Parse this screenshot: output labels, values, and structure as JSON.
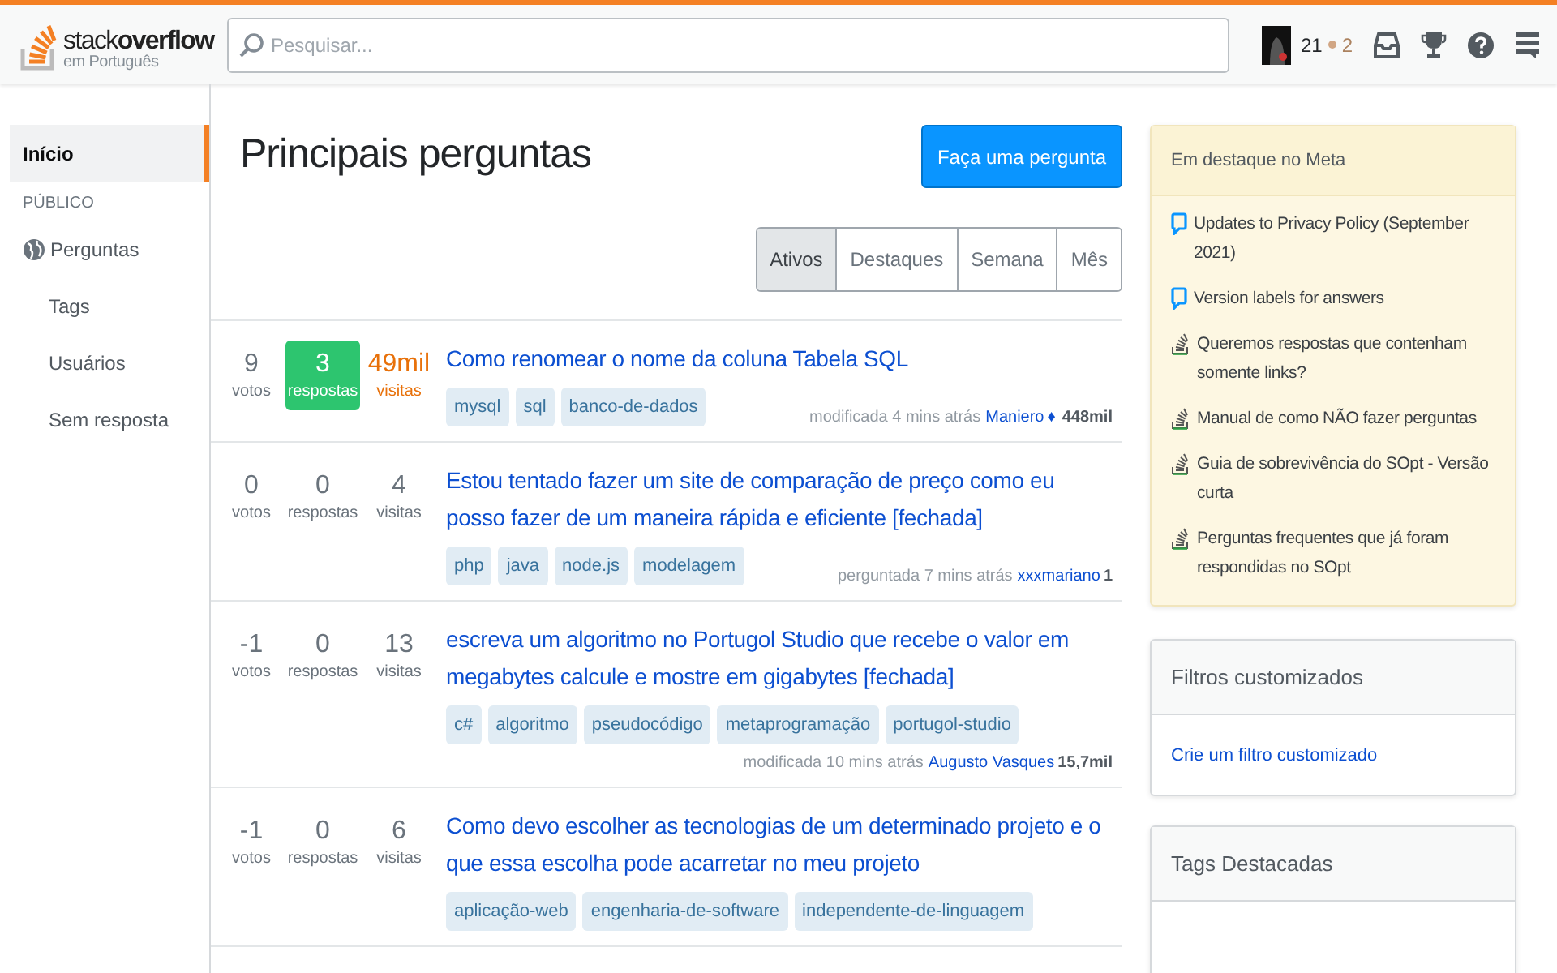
{
  "header": {
    "logo_main": "stack",
    "logo_bold": "overflow",
    "logo_sub": "em Português",
    "search": {
      "placeholder": "Pesquisar..."
    },
    "reputation": "21",
    "bronze": "2"
  },
  "sidebar": {
    "items": [
      {
        "label": "Início",
        "selected": true
      }
    ],
    "section": {
      "title": "PÚBLICO",
      "items": [
        {
          "label": "Perguntas",
          "kind": "globe",
          "selected": false
        },
        {
          "label": "Tags",
          "kind": "sub",
          "selected": false
        },
        {
          "label": "Usuários",
          "kind": "sub",
          "selected": false
        },
        {
          "label": "Sem resposta",
          "kind": "sub",
          "selected": false
        }
      ]
    }
  },
  "main": {
    "title": "Principais perguntas",
    "ask_button": "Faça uma pergunta",
    "tabs": [
      {
        "label": "Ativos",
        "selected": true
      },
      {
        "label": "Destaques",
        "selected": false
      },
      {
        "label": "Semana",
        "selected": false
      },
      {
        "label": "Mês",
        "selected": false
      }
    ],
    "questions": [
      {
        "votes": "9",
        "votes_label": "votos",
        "answers": "3",
        "answers_label": "respostas",
        "answered": true,
        "views": "49mil",
        "views_label": "visitas",
        "hot": true,
        "title": "Como renomear o nome da coluna Tabela SQL",
        "tags": [
          "mysql",
          "sql",
          "banco-de-dados"
        ],
        "action": "modificada 4 mins atrás",
        "user": "Maniero",
        "diamond": "♦",
        "rep": "448mil"
      },
      {
        "votes": "0",
        "votes_label": "votos",
        "answers": "0",
        "answers_label": "respostas",
        "answered": false,
        "views": "4",
        "views_label": "visitas",
        "hot": false,
        "title": "Estou tentado fazer um site de comparação de preço como eu posso fazer de um maneira rápida e eficiente [fechada]",
        "tags": [
          "php",
          "java",
          "node.js",
          "modelagem"
        ],
        "action": "perguntada 7 mins atrás",
        "user": "xxxmariano",
        "rep": "1"
      },
      {
        "votes": "-1",
        "votes_label": "votos",
        "answers": "0",
        "answers_label": "respostas",
        "answered": false,
        "views": "13",
        "views_label": "visitas",
        "hot": false,
        "title": "escreva um algoritmo no Portugol Studio que recebe o valor em megabytes calcule e mostre em gigabytes [fechada]",
        "tags": [
          "c#",
          "algoritmo",
          "pseudocódigo",
          "metaprogramação",
          "portugol-studio"
        ],
        "action": "modificada 10 mins atrás",
        "user": "Augusto Vasques",
        "rep": "15,7mil"
      },
      {
        "votes": "-1",
        "votes_label": "votos",
        "answers": "0",
        "answers_label": "respostas",
        "answered": false,
        "views": "6",
        "views_label": "visitas",
        "hot": false,
        "title": "Como devo escolher as tecnologias de um determinado projeto e o que essa escolha pode acarretar no meu projeto",
        "tags": [
          "aplicação-web",
          "engenharia-de-software",
          "independente-de-linguagem"
        ]
      }
    ]
  },
  "meta_box": {
    "title": "Em destaque no Meta",
    "items": [
      {
        "kind": "blog",
        "text": "Updates to Privacy Policy (September 2021)"
      },
      {
        "kind": "blog",
        "text": "Version labels for answers"
      },
      {
        "kind": "meta",
        "text": "Queremos respostas que contenham somente links?"
      },
      {
        "kind": "meta",
        "text": "Manual de como NÃO fazer perguntas"
      },
      {
        "kind": "meta",
        "text": "Guia de sobrevivência do SOpt - Versão curta"
      },
      {
        "kind": "meta",
        "text": "Perguntas frequentes que já foram respondidas no SOpt"
      }
    ]
  },
  "filters_box": {
    "title": "Filtros customizados",
    "link": "Crie um filtro customizado"
  },
  "tags_box": {
    "title": "Tags Destacadas"
  }
}
